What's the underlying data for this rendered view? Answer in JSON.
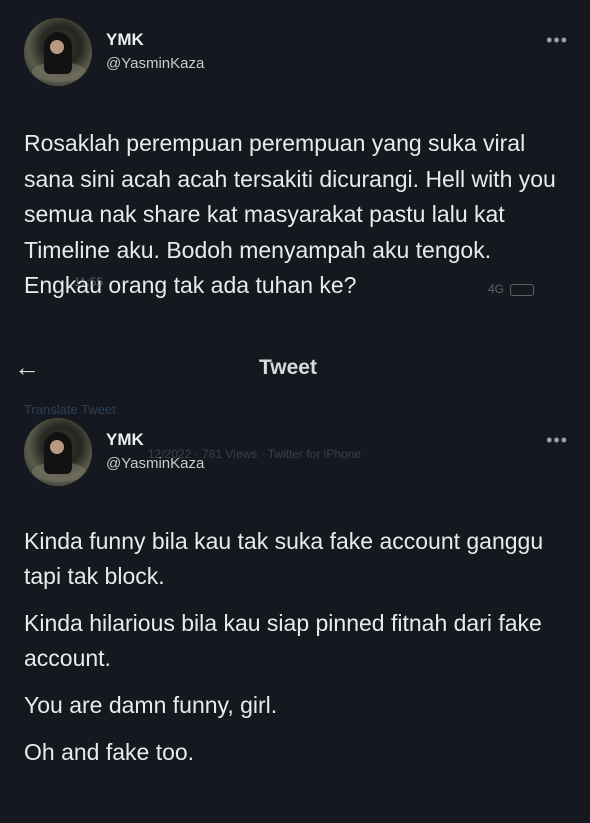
{
  "nav": {
    "back_icon": "arrow-left-icon",
    "title": "Tweet"
  },
  "ghost": {
    "translate": "Translate Tweet",
    "meta": "12/2022 · 781 Views · Twitter for iPhone",
    "time": "11:55",
    "battery": "4G"
  },
  "tweets": [
    {
      "name": "YMK",
      "handle": "@YasminKaza",
      "more_icon": "more-horizontal-icon",
      "text": "Rosaklah perempuan perempuan yang suka viral sana sini acah acah tersakiti dicurangi. Hell with you semua nak share kat masyarakat pastu lalu kat Timeline aku. Bodoh menyampah aku tengok. Engkau orang tak ada tuhan ke?"
    },
    {
      "name": "YMK",
      "handle": "@YasminKaza",
      "more_icon": "more-horizontal-icon",
      "paragraphs": [
        "Kinda funny bila kau tak suka fake account ganggu tapi tak block.",
        "Kinda hilarious bila kau siap pinned fitnah dari fake account.",
        "You are damn funny, girl.",
        "Oh and fake too."
      ]
    }
  ]
}
